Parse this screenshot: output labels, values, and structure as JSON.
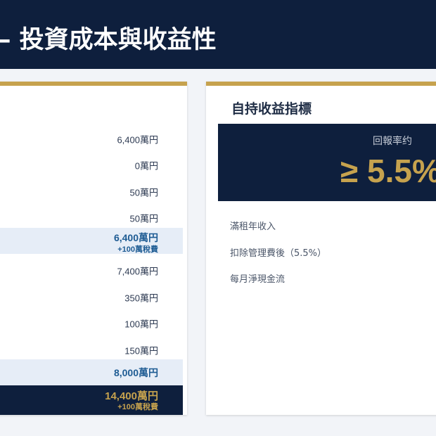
{
  "header": {
    "title": "– 投資成本與收益性"
  },
  "cost_table": {
    "rows": [
      {
        "value": "6,400萬円"
      },
      {
        "value": "0萬円"
      },
      {
        "value": "50萬円"
      },
      {
        "value": "50萬円"
      },
      {
        "value": "6,400萬円",
        "note": "+100萬稅費"
      },
      {
        "value": "7,400萬円"
      },
      {
        "value": "350萬円"
      },
      {
        "value": "100萬円"
      },
      {
        "value": "150萬円"
      },
      {
        "value": "8,000萬円"
      },
      {
        "value": "14,400萬円",
        "note": "+100萬稅費"
      }
    ]
  },
  "yield_card": {
    "title": "自持收益指標",
    "metric_label": "回報率约",
    "metric_value": "≥ 5.5%",
    "lines": [
      "滿租年收入",
      "扣除管理費後（5.5%）",
      "每月淨現金流"
    ]
  },
  "colors": {
    "navy": "#0e1f3d",
    "gold": "#c6a24e",
    "subtotal_bg": "#e6edf7",
    "subtotal_text": "#1d5b93"
  }
}
